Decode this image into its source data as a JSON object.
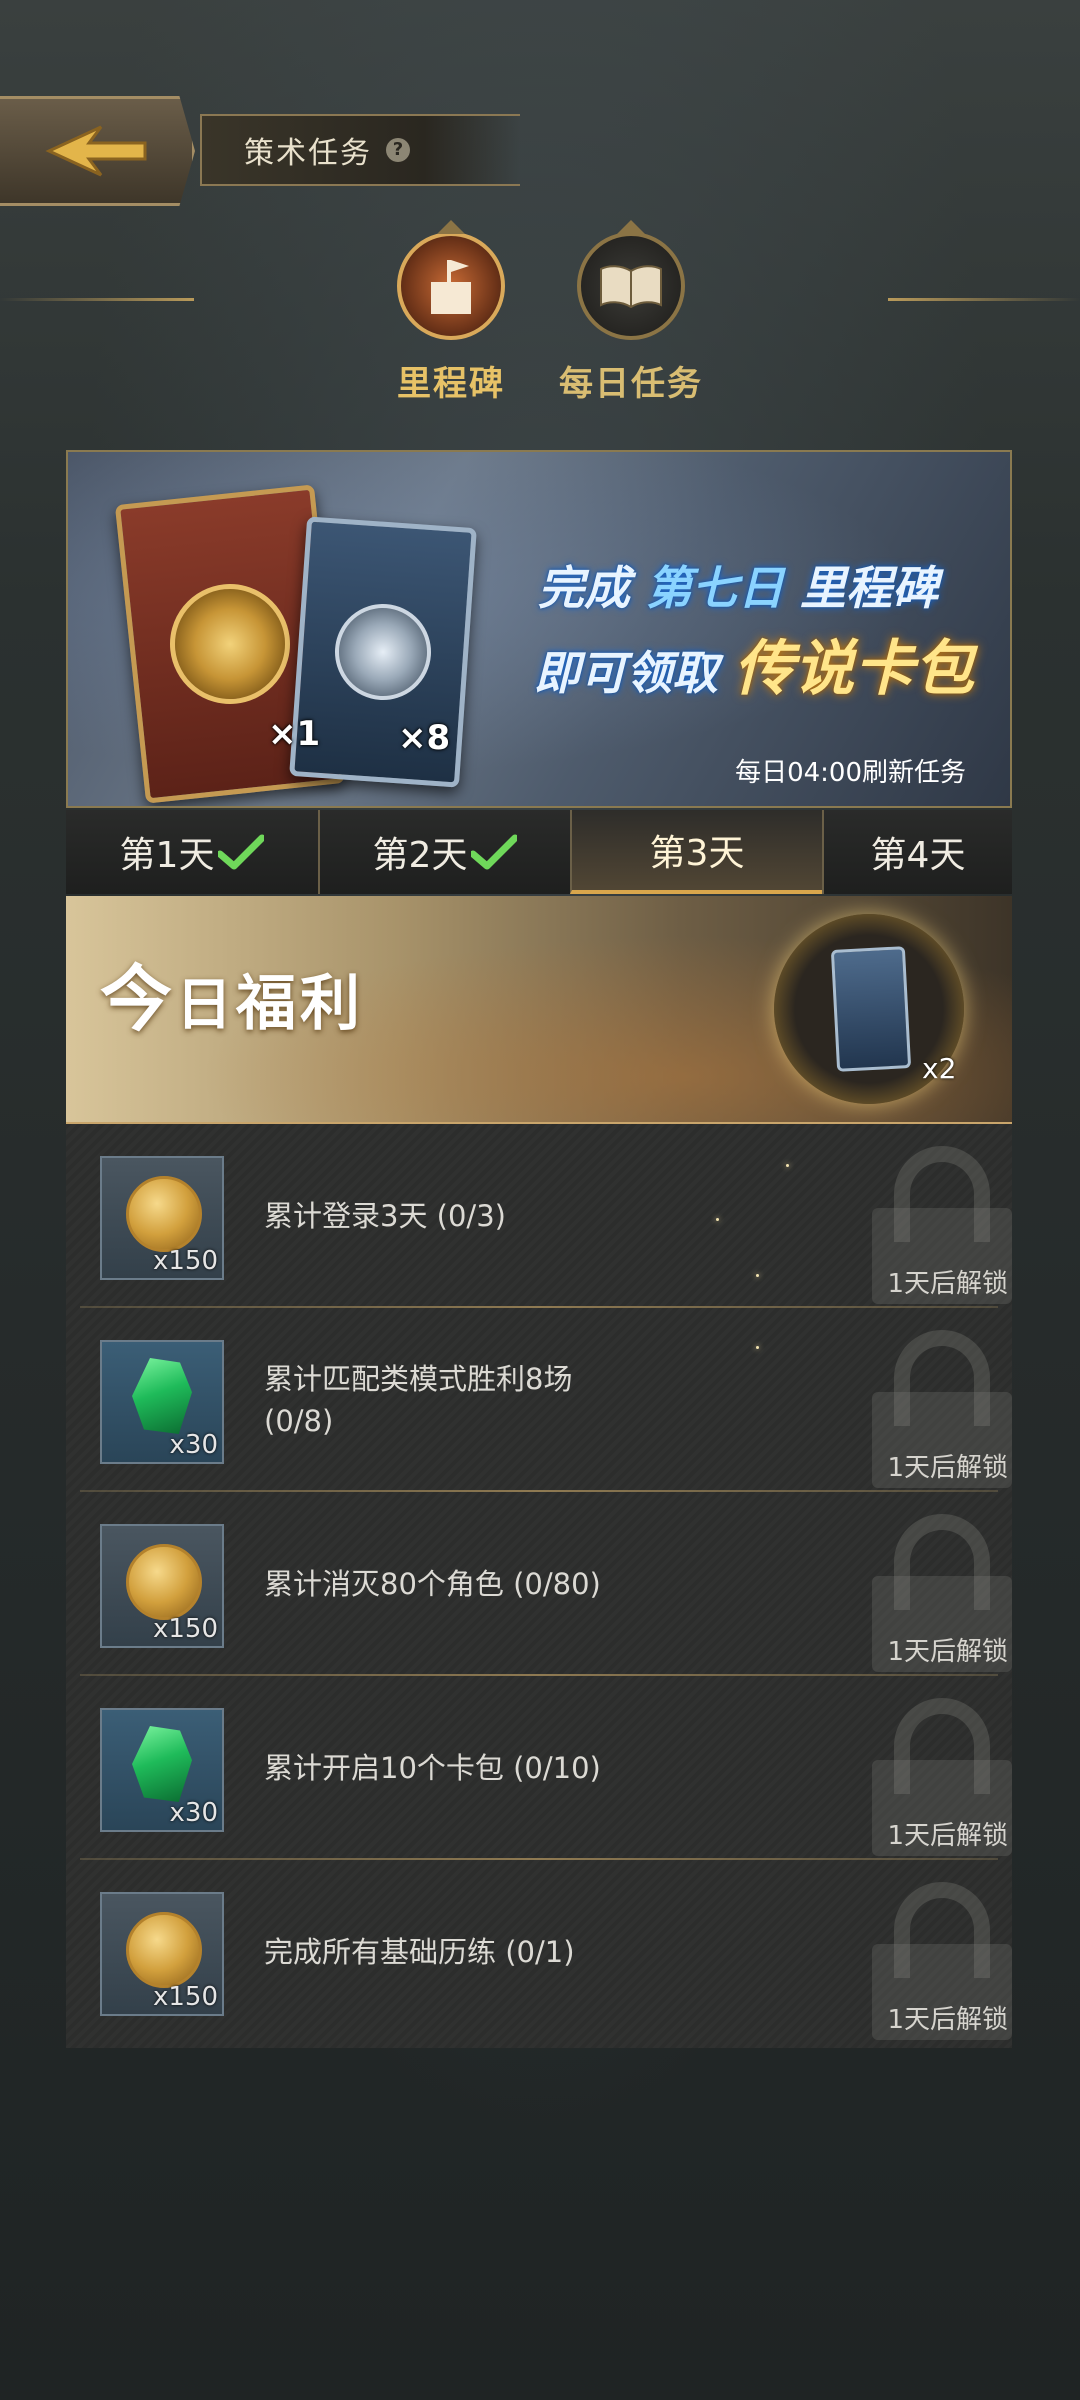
{
  "header": {
    "title": "策术任务",
    "help": "?"
  },
  "modes": [
    {
      "label": "里程碑",
      "active": true,
      "icon": "milestone-flag-icon"
    },
    {
      "label": "每日任务",
      "active": false,
      "icon": "book-icon"
    }
  ],
  "banner": {
    "line1_a": "完成 ",
    "line1_b": "第七日",
    "line1_c": " 里程碑",
    "line2_a": "即可领取",
    "line2_b": "传说卡包",
    "card1_qty": "×1",
    "card2_qty": "×8",
    "refresh": "每日04:00刷新任务"
  },
  "days": [
    {
      "label": "第1天",
      "done": true
    },
    {
      "label": "第2天",
      "done": true
    },
    {
      "label": "第3天",
      "done": false,
      "active": true
    },
    {
      "label": "第4天",
      "done": false
    }
  ],
  "benefit": {
    "title_a": "今",
    "title_b": "日",
    "title_c": "福利",
    "qty": "x2"
  },
  "tasks": [
    {
      "reward": "coin",
      "qty": "x150",
      "text": "累计登录3天 (0/3)",
      "status": "1天后解锁"
    },
    {
      "reward": "gem",
      "qty": "x30",
      "text": "累计匹配类模式胜利8场 (0/8)",
      "status": "1天后解锁"
    },
    {
      "reward": "coin",
      "qty": "x150",
      "text": "累计消灭80个角色 (0/80)",
      "status": "1天后解锁"
    },
    {
      "reward": "gem",
      "qty": "x30",
      "text": "累计开启10个卡包 (0/10)",
      "status": "1天后解锁"
    },
    {
      "reward": "coin",
      "qty": "x150",
      "text": "完成所有基础历练 (0/1)",
      "status": "1天后解锁"
    }
  ]
}
